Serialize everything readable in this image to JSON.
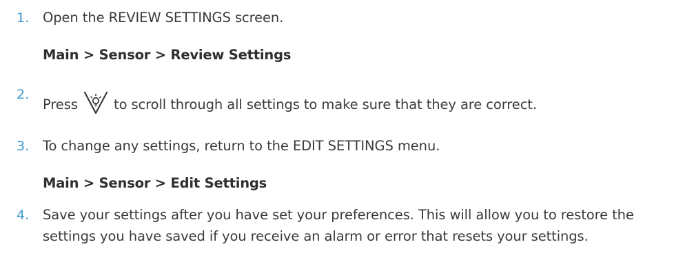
{
  "steps": [
    {
      "number": "1.",
      "text": "Open the REVIEW SETTINGS screen.",
      "path": "Main > Sensor > Review Settings"
    },
    {
      "number": "2.",
      "text_before_icon": "Press",
      "icon": "scroll-button-icon",
      "text_after_icon": "to scroll through all settings to make sure that they are correct."
    },
    {
      "number": "3.",
      "text": "To change any settings, return to the EDIT SETTINGS menu.",
      "path": "Main > Sensor > Edit Settings"
    },
    {
      "number": "4.",
      "text": "Save your settings after you have set your preferences. This will allow you to restore the settings you have saved if you receive an alarm or error that resets your settings."
    }
  ],
  "colors": {
    "number": "#3f9ad0",
    "text": "#3a3a3a"
  }
}
